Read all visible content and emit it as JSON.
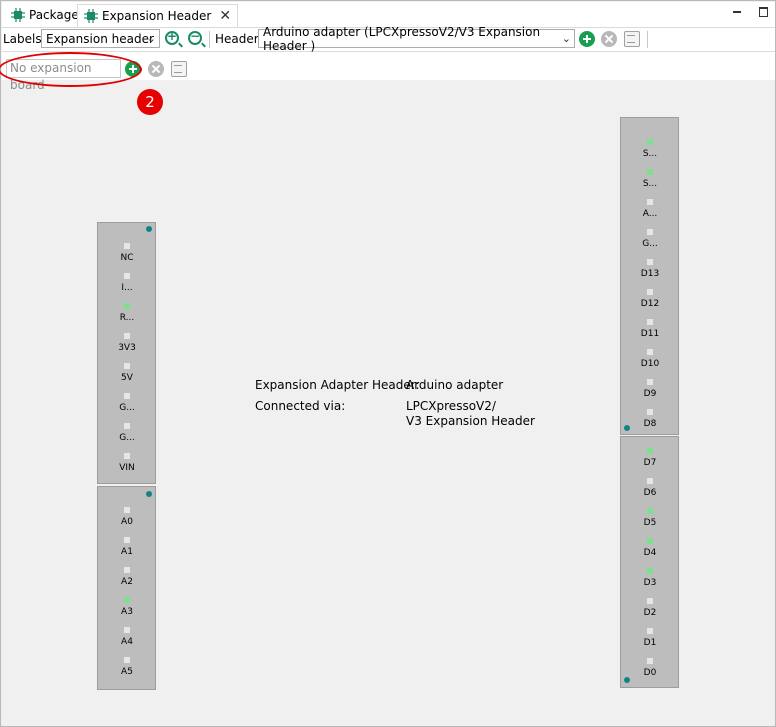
{
  "tabs": [
    {
      "label": "Package",
      "icon": "chip-icon",
      "active": false
    },
    {
      "label": "Expansion Header",
      "icon": "chip-icon",
      "active": true
    }
  ],
  "toolbar": {
    "labels_label": "Labels",
    "labels_select": "Expansion header",
    "header_label": "Header",
    "header_select": "Arduino adapter (LPCXpressoV2/V3 Expansion Header )"
  },
  "board": {
    "placeholder": "No expansion board",
    "annotation_number": "2"
  },
  "info": {
    "adapter_key": "Expansion Adapter Header:",
    "adapter_value": "Arduino adapter",
    "connected_key": "Connected via:",
    "connected_value_1": "LPCXpressoV2/",
    "connected_value_2": "V3 Expansion Header"
  },
  "left_top_pins": [
    {
      "label": "NC",
      "active": false
    },
    {
      "label": "I...",
      "active": false
    },
    {
      "label": "R...",
      "active": true
    },
    {
      "label": "3V3",
      "active": false
    },
    {
      "label": "5V",
      "active": false
    },
    {
      "label": "G...",
      "active": false
    },
    {
      "label": "G...",
      "active": false
    },
    {
      "label": "VIN",
      "active": false
    }
  ],
  "left_bottom_pins": [
    {
      "label": "A0",
      "active": false
    },
    {
      "label": "A1",
      "active": false
    },
    {
      "label": "A2",
      "active": false
    },
    {
      "label": "A3",
      "active": true
    },
    {
      "label": "A4",
      "active": false
    },
    {
      "label": "A5",
      "active": false
    }
  ],
  "right_top_pins": [
    {
      "label": "S...",
      "active": true
    },
    {
      "label": "S...",
      "active": true
    },
    {
      "label": "A...",
      "active": false
    },
    {
      "label": "G...",
      "active": false
    },
    {
      "label": "D13",
      "active": false
    },
    {
      "label": "D12",
      "active": false
    },
    {
      "label": "D11",
      "active": false
    },
    {
      "label": "D10",
      "active": false
    },
    {
      "label": "D9",
      "active": false
    },
    {
      "label": "D8",
      "active": false
    }
  ],
  "right_bottom_pins": [
    {
      "label": "D7",
      "active": true
    },
    {
      "label": "D6",
      "active": false
    },
    {
      "label": "D5",
      "active": true
    },
    {
      "label": "D4",
      "active": true
    },
    {
      "label": "D3",
      "active": true
    },
    {
      "label": "D2",
      "active": false
    },
    {
      "label": "D1",
      "active": false
    },
    {
      "label": "D0",
      "active": false
    }
  ]
}
